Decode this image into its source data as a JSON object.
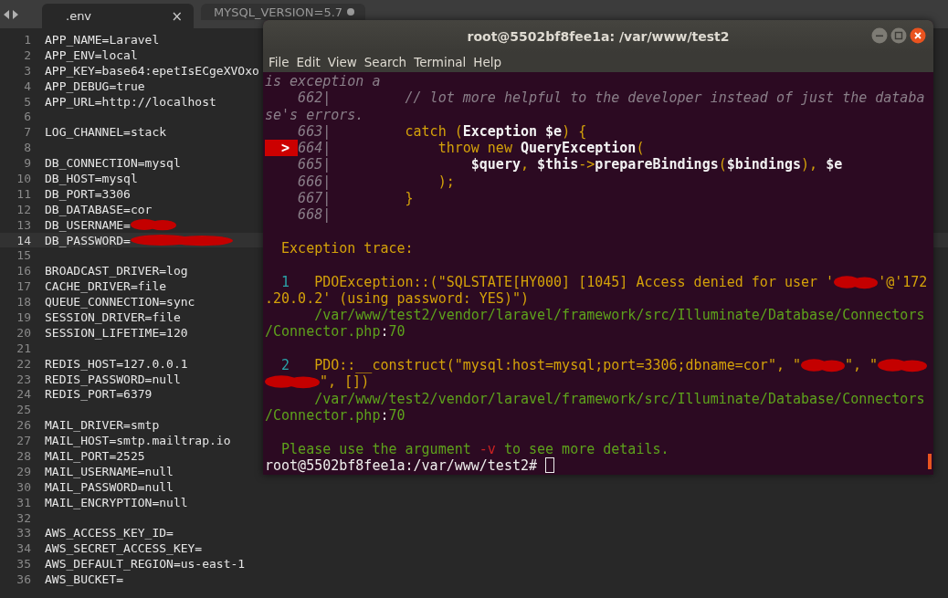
{
  "editor": {
    "tabs": [
      {
        "label": ".env",
        "selected": true,
        "close_glyph": "×",
        "modified": false
      },
      {
        "label": "MYSQL_VERSION=5.7",
        "selected": false,
        "modified": true
      }
    ],
    "lines": [
      {
        "number": "1",
        "text": "APP_NAME=Laravel"
      },
      {
        "number": "2",
        "text": "APP_ENV=local"
      },
      {
        "number": "3",
        "text": "APP_KEY=base64:epetIsECgeXVOxo"
      },
      {
        "number": "4",
        "text": "APP_DEBUG=true"
      },
      {
        "number": "5",
        "text": "APP_URL=http://localhost"
      },
      {
        "number": "6"
      },
      {
        "number": "7",
        "text": "LOG_CHANNEL=stack"
      },
      {
        "number": "8"
      },
      {
        "number": "9",
        "text": "DB_CONNECTION=mysql"
      },
      {
        "number": "10",
        "text": "DB_HOST=mysql"
      },
      {
        "number": "11",
        "text": "DB_PORT=3306"
      },
      {
        "number": "12",
        "text": "DB_DATABASE=cor"
      },
      {
        "number": "13",
        "text": "DB_USERNAME=",
        "redacted": true
      },
      {
        "number": "14",
        "text": "DB_PASSWORD=",
        "redacted": true,
        "current": true
      },
      {
        "number": "15"
      },
      {
        "number": "16",
        "text": "BROADCAST_DRIVER=log"
      },
      {
        "number": "17",
        "text": "CACHE_DRIVER=file"
      },
      {
        "number": "18",
        "text": "QUEUE_CONNECTION=sync"
      },
      {
        "number": "19",
        "text": "SESSION_DRIVER=file"
      },
      {
        "number": "20",
        "text": "SESSION_LIFETIME=120"
      },
      {
        "number": "21"
      },
      {
        "number": "22",
        "text": "REDIS_HOST=127.0.0.1"
      },
      {
        "number": "23",
        "text": "REDIS_PASSWORD=null"
      },
      {
        "number": "24",
        "text": "REDIS_PORT=6379"
      },
      {
        "number": "25"
      },
      {
        "number": "26",
        "text": "MAIL_DRIVER=smtp"
      },
      {
        "number": "27",
        "text": "MAIL_HOST=smtp.mailtrap.io"
      },
      {
        "number": "28",
        "text": "MAIL_PORT=2525"
      },
      {
        "number": "29",
        "text": "MAIL_USERNAME=null"
      },
      {
        "number": "30",
        "text": "MAIL_PASSWORD=null"
      },
      {
        "number": "31",
        "text": "MAIL_ENCRYPTION=null"
      },
      {
        "number": "32"
      },
      {
        "number": "33",
        "text": "AWS_ACCESS_KEY_ID="
      },
      {
        "number": "34",
        "text": "AWS_SECRET_ACCESS_KEY="
      },
      {
        "number": "35",
        "text": "AWS_DEFAULT_REGION=us-east-1"
      },
      {
        "number": "36",
        "text": "AWS_BUCKET="
      }
    ]
  },
  "terminal": {
    "title": "root@5502bf8fee1a: /var/www/test2",
    "menu": [
      "File",
      "Edit",
      "View",
      "Search",
      "Terminal",
      "Help"
    ],
    "lines": [
      {
        "segments": [
          {
            "text": "is exception a",
            "kind": "comment"
          }
        ]
      },
      {
        "segments": [
          {
            "text": "    662|",
            "kind": "lineno"
          },
          {
            "text": "         // lot more helpful to the developer instead of just the databa",
            "kind": "comment"
          }
        ]
      },
      {
        "segments": [
          {
            "text": "se's errors.",
            "kind": "comment"
          }
        ]
      },
      {
        "segments": [
          {
            "text": "    663|",
            "kind": "lineno"
          },
          {
            "text": "         catch (",
            "kind": "keyword"
          },
          {
            "text": "Exception $e",
            "kind": "name"
          },
          {
            "text": ") {",
            "kind": "keyword"
          }
        ]
      },
      {
        "segments": [
          {
            "text": "  > ",
            "kind": "marker"
          },
          {
            "text": "664|",
            "kind": "lineno"
          },
          {
            "text": "             throw new ",
            "kind": "keyword"
          },
          {
            "text": "QueryException",
            "kind": "name"
          },
          {
            "text": "(",
            "kind": "keyword"
          }
        ]
      },
      {
        "segments": [
          {
            "text": "    665|                 ",
            "kind": "lineno"
          },
          {
            "text": "$query",
            "kind": "name"
          },
          {
            "text": ", ",
            "kind": "keyword"
          },
          {
            "text": "$this",
            "kind": "name"
          },
          {
            "text": "->",
            "kind": "keyword"
          },
          {
            "text": "prepareBindings",
            "kind": "name"
          },
          {
            "text": "(",
            "kind": "keyword"
          },
          {
            "text": "$bindings",
            "kind": "name"
          },
          {
            "text": "), ",
            "kind": "keyword"
          },
          {
            "text": "$e",
            "kind": "name"
          }
        ]
      },
      {
        "segments": [
          {
            "text": "    666|",
            "kind": "lineno"
          },
          {
            "text": "             );",
            "kind": "keyword"
          }
        ]
      },
      {
        "segments": [
          {
            "text": "    667|",
            "kind": "lineno"
          },
          {
            "text": "         }",
            "kind": "keyword"
          }
        ]
      },
      {
        "segments": [
          {
            "text": "    668|",
            "kind": "lineno"
          }
        ]
      },
      {
        "space_before": true,
        "segments": [
          {
            "text": "  Exception trace:",
            "kind": "heading"
          }
        ]
      },
      {
        "space_before": true,
        "segments": [
          {
            "text": "  1",
            "kind": "index"
          },
          {
            "text": "   PDOException::(\"SQLSTATE[HY000] [1045] Access denied for user '",
            "kind": "message"
          },
          {
            "kind": "redaction"
          },
          {
            "text": "'@'172",
            "kind": "message"
          }
        ]
      },
      {
        "segments": [
          {
            "text": ".20.0.2' (using password: YES)\")",
            "kind": "message"
          }
        ]
      },
      {
        "segments": [
          {
            "text": "      /var/www/test2/vendor/laravel/framework/src/Illuminate/Database/Connectors",
            "kind": "path"
          }
        ]
      },
      {
        "segments": [
          {
            "text": "/Connector.php",
            "kind": "path"
          },
          {
            "text": ":",
            "kind": "plain"
          },
          {
            "text": "70",
            "kind": "path"
          }
        ]
      },
      {
        "space_before": true,
        "segments": [
          {
            "text": "  2",
            "kind": "index"
          },
          {
            "text": "   PDO::__construct(\"mysql:host=mysql;port=3306;dbname=cor\", \"",
            "kind": "message"
          },
          {
            "kind": "redaction"
          },
          {
            "text": "\", \"",
            "kind": "message"
          },
          {
            "kind": "redaction"
          }
        ]
      },
      {
        "segments": [
          {
            "kind": "redaction"
          },
          {
            "text": "\", [])",
            "kind": "message"
          }
        ]
      },
      {
        "segments": [
          {
            "text": "      /var/www/test2/vendor/laravel/framework/src/Illuminate/Database/Connectors",
            "kind": "path"
          }
        ]
      },
      {
        "segments": [
          {
            "text": "/Connector.php",
            "kind": "path"
          },
          {
            "text": ":",
            "kind": "plain"
          },
          {
            "text": "70",
            "kind": "path"
          }
        ]
      },
      {
        "space_before": true,
        "segments": [
          {
            "text": "  Please use the argument ",
            "kind": "hint"
          },
          {
            "text": "-v",
            "kind": "flag"
          },
          {
            "text": " to see more details.",
            "kind": "hint"
          }
        ]
      },
      {
        "segments": [
          {
            "text": "root@5502bf8fee1a:/var/www/test2# ",
            "kind": "plain"
          },
          {
            "kind": "cursor"
          }
        ]
      }
    ]
  }
}
